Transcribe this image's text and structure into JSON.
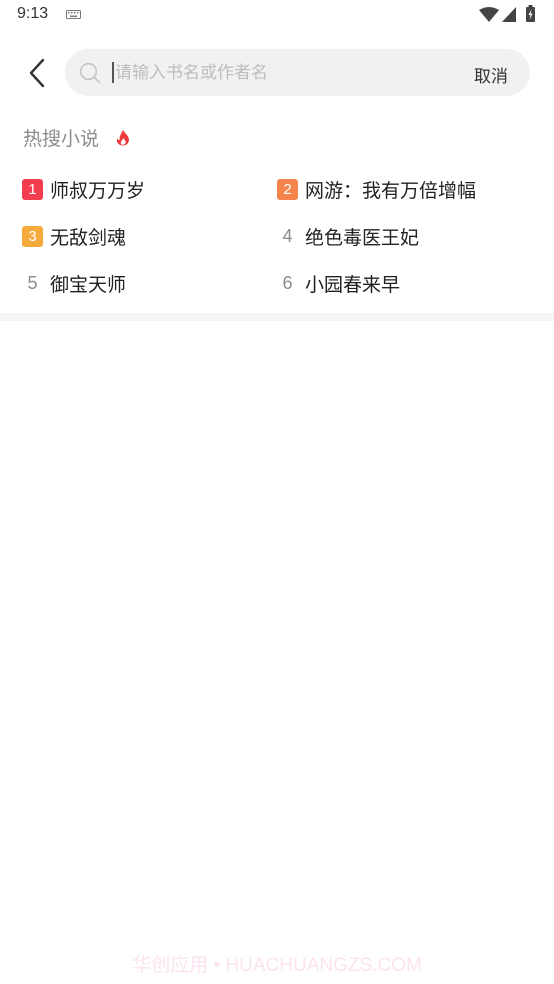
{
  "status_bar": {
    "time": "9:13"
  },
  "search": {
    "placeholder": "请输入书名或作者名",
    "value": "",
    "cancel_label": "取消"
  },
  "hot": {
    "title": "热搜小说",
    "items": [
      {
        "rank": "1",
        "title": "师叔万万岁",
        "badge_color": "#f23d4f"
      },
      {
        "rank": "2",
        "title": "网游：我有万倍增幅",
        "badge_color": "#f5844a"
      },
      {
        "rank": "3",
        "title": "无敌剑魂",
        "badge_color": "#f5ab3b"
      },
      {
        "rank": "4",
        "title": "绝色毒医王妃"
      },
      {
        "rank": "5",
        "title": "御宝天师"
      },
      {
        "rank": "6",
        "title": "小园春来早"
      }
    ]
  },
  "watermark": "华创应用 • HUACHUANGZS.COM",
  "colors": {
    "accent_red": "#f23d4f",
    "accent_orange": "#f5844a",
    "accent_yellow": "#f5ab3b",
    "search_bg": "#f1f1f1"
  },
  "icons": [
    "keyboard-icon",
    "wifi-icon",
    "signal-icon",
    "battery-icon",
    "back-icon",
    "search-icon",
    "fire-icon"
  ]
}
